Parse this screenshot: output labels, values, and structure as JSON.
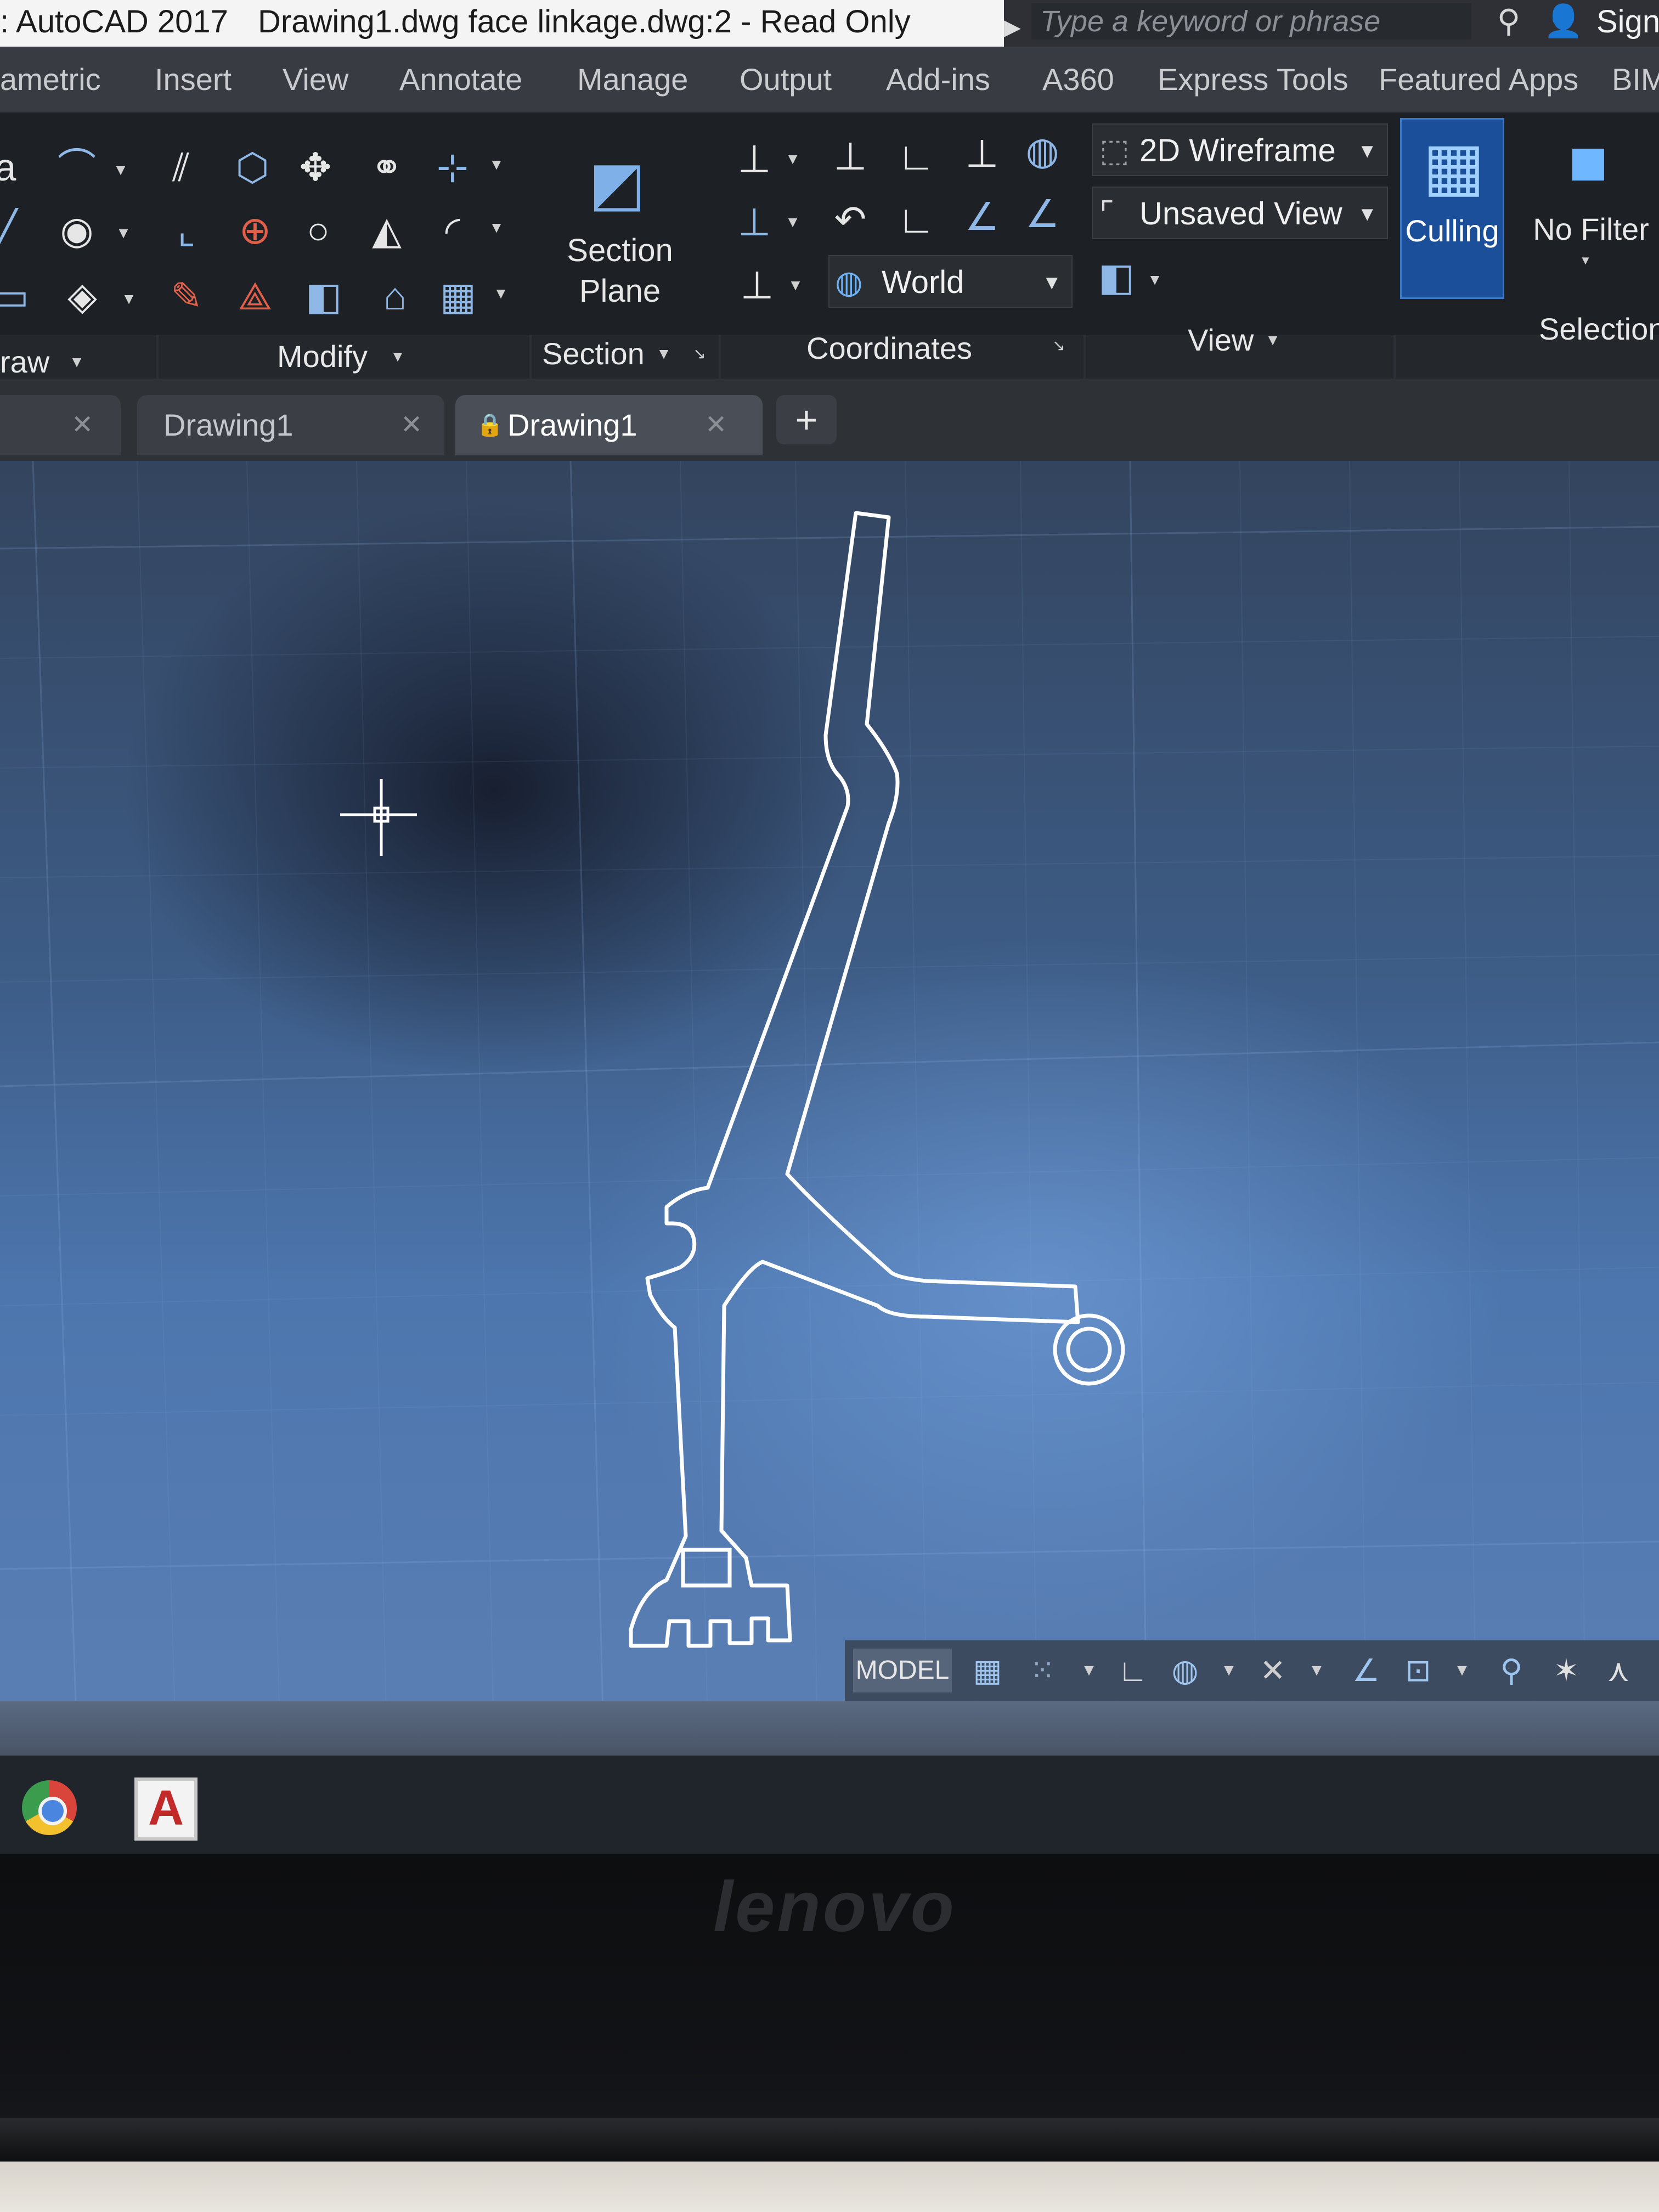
{
  "title_bar": {
    "app_title": ": AutoCAD 2017",
    "document_title": "Drawing1.dwg face linkage.dwg:2 - Read Only",
    "search_placeholder": "Type a keyword or phrase",
    "sign_in_label": "Sign"
  },
  "menu_tabs": [
    "ametric",
    "Insert",
    "View",
    "Annotate",
    "Manage",
    "Output",
    "Add-ins",
    "A360",
    "Express Tools",
    "Featured Apps",
    "BIM"
  ],
  "ribbon": {
    "panels": {
      "draw": "raw",
      "modify": "Modify",
      "section": "Section",
      "coordinates": "Coordinates",
      "view": "View",
      "selection": "Selection"
    },
    "section_plane": {
      "line1": "Section",
      "line2": "Plane"
    },
    "visual_style": "2D Wireframe",
    "named_view": "Unsaved View",
    "ucs": "World",
    "culling": "Culling",
    "no_filter": "No Filter"
  },
  "file_tabs": [
    {
      "label": "",
      "active": false
    },
    {
      "label": "Drawing1",
      "active": false
    },
    {
      "label": "Drawing1",
      "active": true,
      "locked": true
    }
  ],
  "new_tab_symbol": "+",
  "status_bar": {
    "model_label": "MODEL"
  },
  "taskbar": {
    "autocad_letter": "A"
  },
  "bezel": {
    "brand": "lenovo"
  },
  "colors": {
    "accent": "#1c4f99",
    "ribbon_bg": "#1d2024",
    "canvas_blue": "#4d76ae",
    "drawing_line": "#ffffff"
  }
}
